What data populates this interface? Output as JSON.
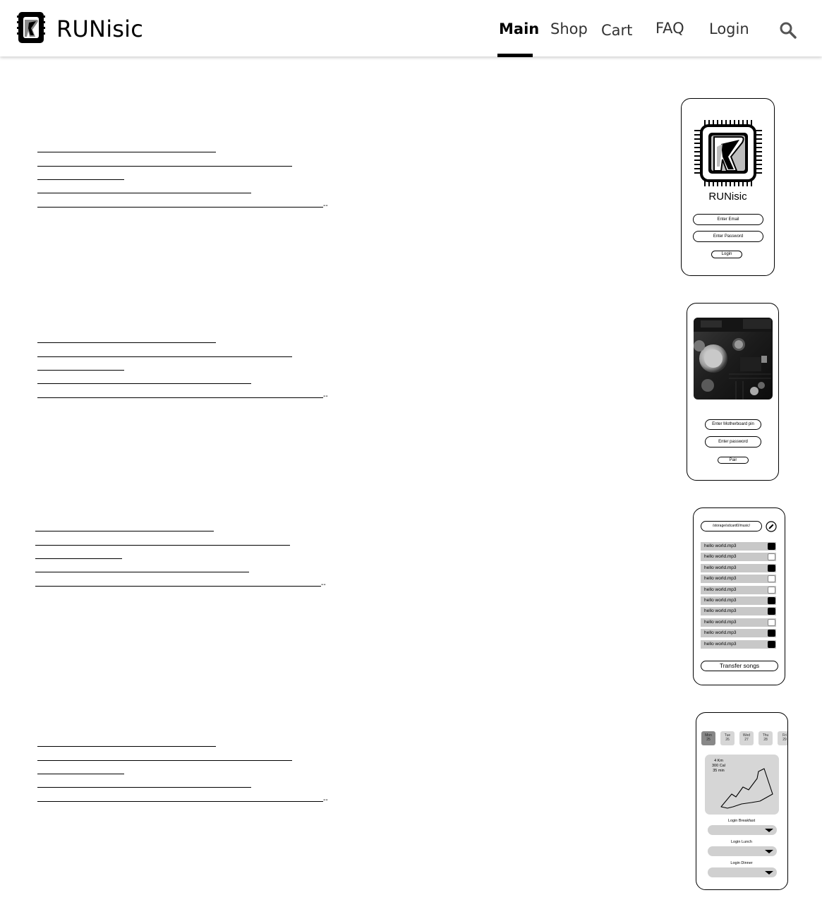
{
  "header": {
    "brand": "RUNisic",
    "nav": [
      {
        "label": "Main",
        "active": true
      },
      {
        "label": "Shop",
        "active": false
      },
      {
        "label": "Cart",
        "active": false
      },
      {
        "label": "FAQ",
        "active": false
      },
      {
        "label": "Login",
        "active": false
      }
    ],
    "search_icon": "search-icon",
    "logo_icon": "runisic-logo-icon"
  },
  "sections": [
    {
      "placeholder_trailing": "--"
    },
    {
      "placeholder_trailing": "--"
    },
    {
      "placeholder_trailing": "--"
    },
    {
      "placeholder_trailing": "--"
    }
  ],
  "login_phone": {
    "title": "RUNisic",
    "email_placeholder": "Enter Email",
    "password_placeholder": "Enter Password",
    "login_button": "Login",
    "logo_icon": "chip-logo-icon"
  },
  "pair_phone": {
    "pin_placeholder": "Enter Motherboard pin",
    "password_placeholder": "Enter password",
    "pair_button": "Pair",
    "image": "circuit-board-photo"
  },
  "music_phone": {
    "path": "/storage/sdcard0/music/",
    "edit_icon": "pencil-icon",
    "songs": [
      {
        "name": "hello world.mp3",
        "checked": true
      },
      {
        "name": "hello world.mp3",
        "checked": false
      },
      {
        "name": "hello world.mp3",
        "checked": true
      },
      {
        "name": "hello world.mp3",
        "checked": false
      },
      {
        "name": "hello world.mp3",
        "checked": false
      },
      {
        "name": "hello world.mp3",
        "checked": true
      },
      {
        "name": "hello world.mp3",
        "checked": true
      },
      {
        "name": "hello world.mp3",
        "checked": false
      },
      {
        "name": "hello world.mp3",
        "checked": true
      },
      {
        "name": "hello world.mp3",
        "checked": true
      }
    ],
    "transfer_button": "Transfer songs"
  },
  "tracker_phone": {
    "days": [
      {
        "day": "Mon",
        "date": "25",
        "selected": true
      },
      {
        "day": "Tue",
        "date": "26",
        "selected": false
      },
      {
        "day": "Wed",
        "date": "27",
        "selected": false
      },
      {
        "day": "Thu",
        "date": "28",
        "selected": false
      },
      {
        "day": "Fri",
        "date": "29",
        "selected": false
      }
    ],
    "stats": {
      "distance": "4 Km",
      "calories": "300 Cal",
      "duration": "35 min"
    },
    "meals": [
      "Login Breakfast",
      "Login Lunch",
      "Login Dinner"
    ]
  }
}
